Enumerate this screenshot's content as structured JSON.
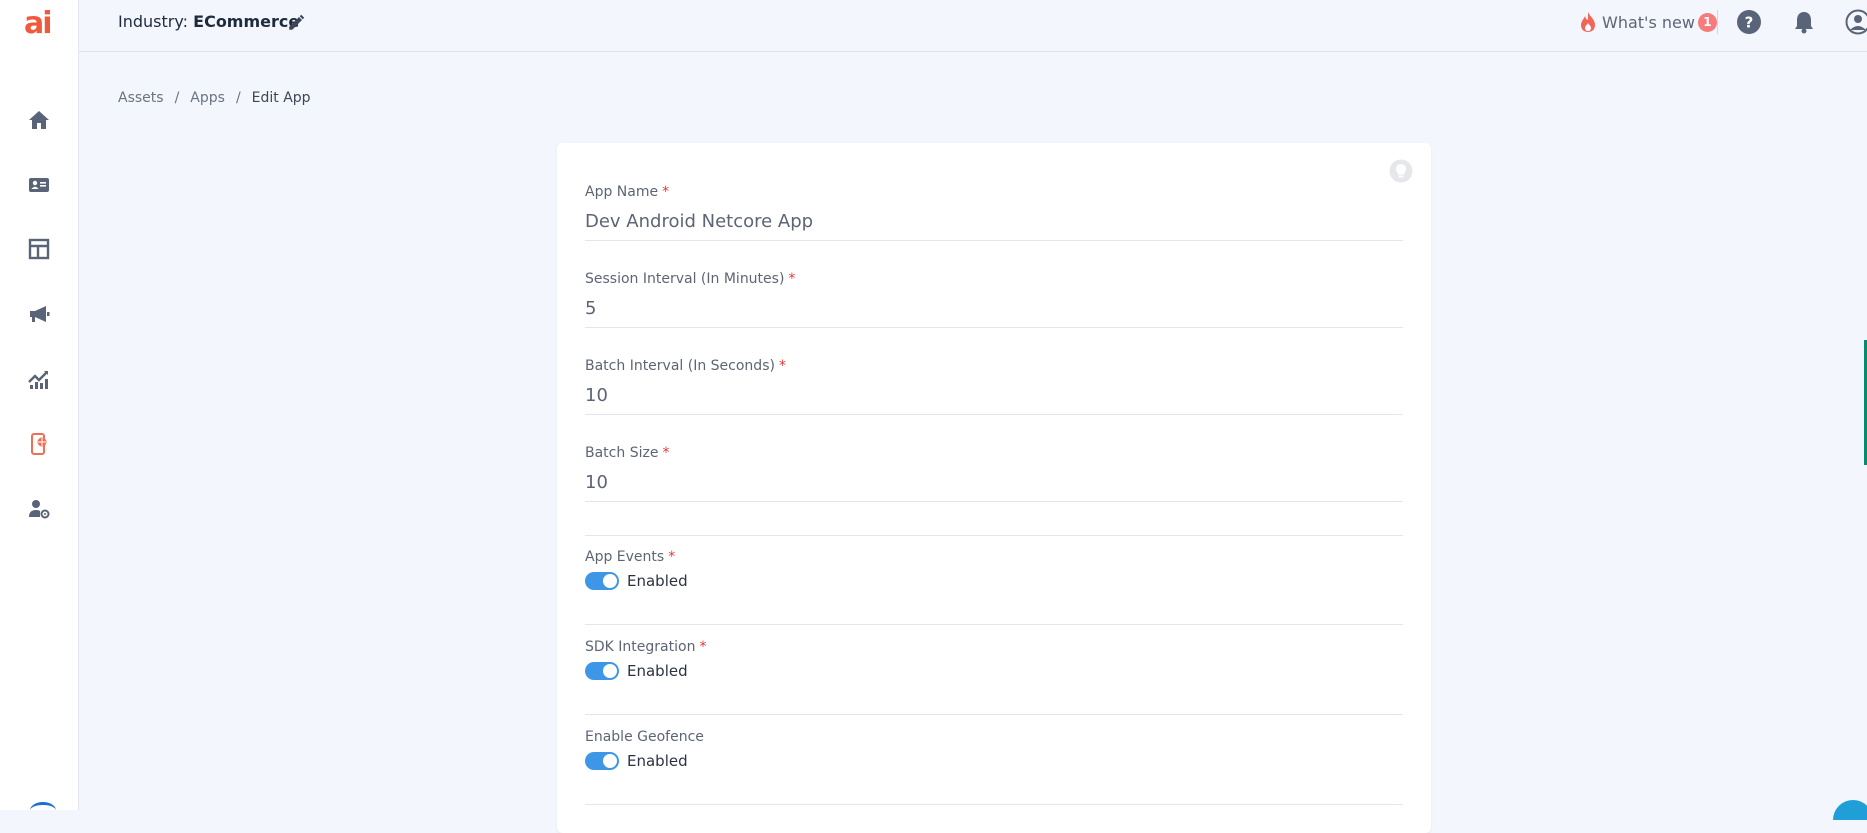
{
  "app": {
    "logo_text": "ai"
  },
  "sidebar": {
    "items": [
      {
        "icon": "home-icon"
      },
      {
        "icon": "contact-card-icon"
      },
      {
        "icon": "layout-icon"
      },
      {
        "icon": "megaphone-icon"
      },
      {
        "icon": "analytics-icon"
      },
      {
        "icon": "mobile-app-icon",
        "active": true
      },
      {
        "icon": "user-settings-icon"
      }
    ]
  },
  "topbar": {
    "industry_label": "Industry:",
    "industry_value": "ECommerce",
    "whats_new_label": "What's new",
    "whats_new_count": "1"
  },
  "breadcrumb": {
    "assets": "Assets",
    "sep": "/",
    "apps": "Apps",
    "current": "Edit App"
  },
  "form": {
    "app_name": {
      "label": "App Name",
      "required": "*",
      "value": "Dev Android Netcore App"
    },
    "session_interval": {
      "label": "Session Interval (In Minutes)",
      "required": "*",
      "value": "5"
    },
    "batch_interval": {
      "label": "Batch Interval (In Seconds)",
      "required": "*",
      "value": "10"
    },
    "batch_size": {
      "label": "Batch Size",
      "required": "*",
      "value": "10"
    },
    "app_events": {
      "label": "App Events",
      "required": "*",
      "state": "Enabled"
    },
    "sdk_integration": {
      "label": "SDK Integration",
      "required": "*",
      "state": "Enabled"
    },
    "geofence": {
      "label": "Enable Geofence",
      "state": "Enabled"
    }
  },
  "colors": {
    "accent": "#3d97e6",
    "brand": "#ef5a3c",
    "badge": "#f77b7b",
    "required": "#e53935"
  }
}
